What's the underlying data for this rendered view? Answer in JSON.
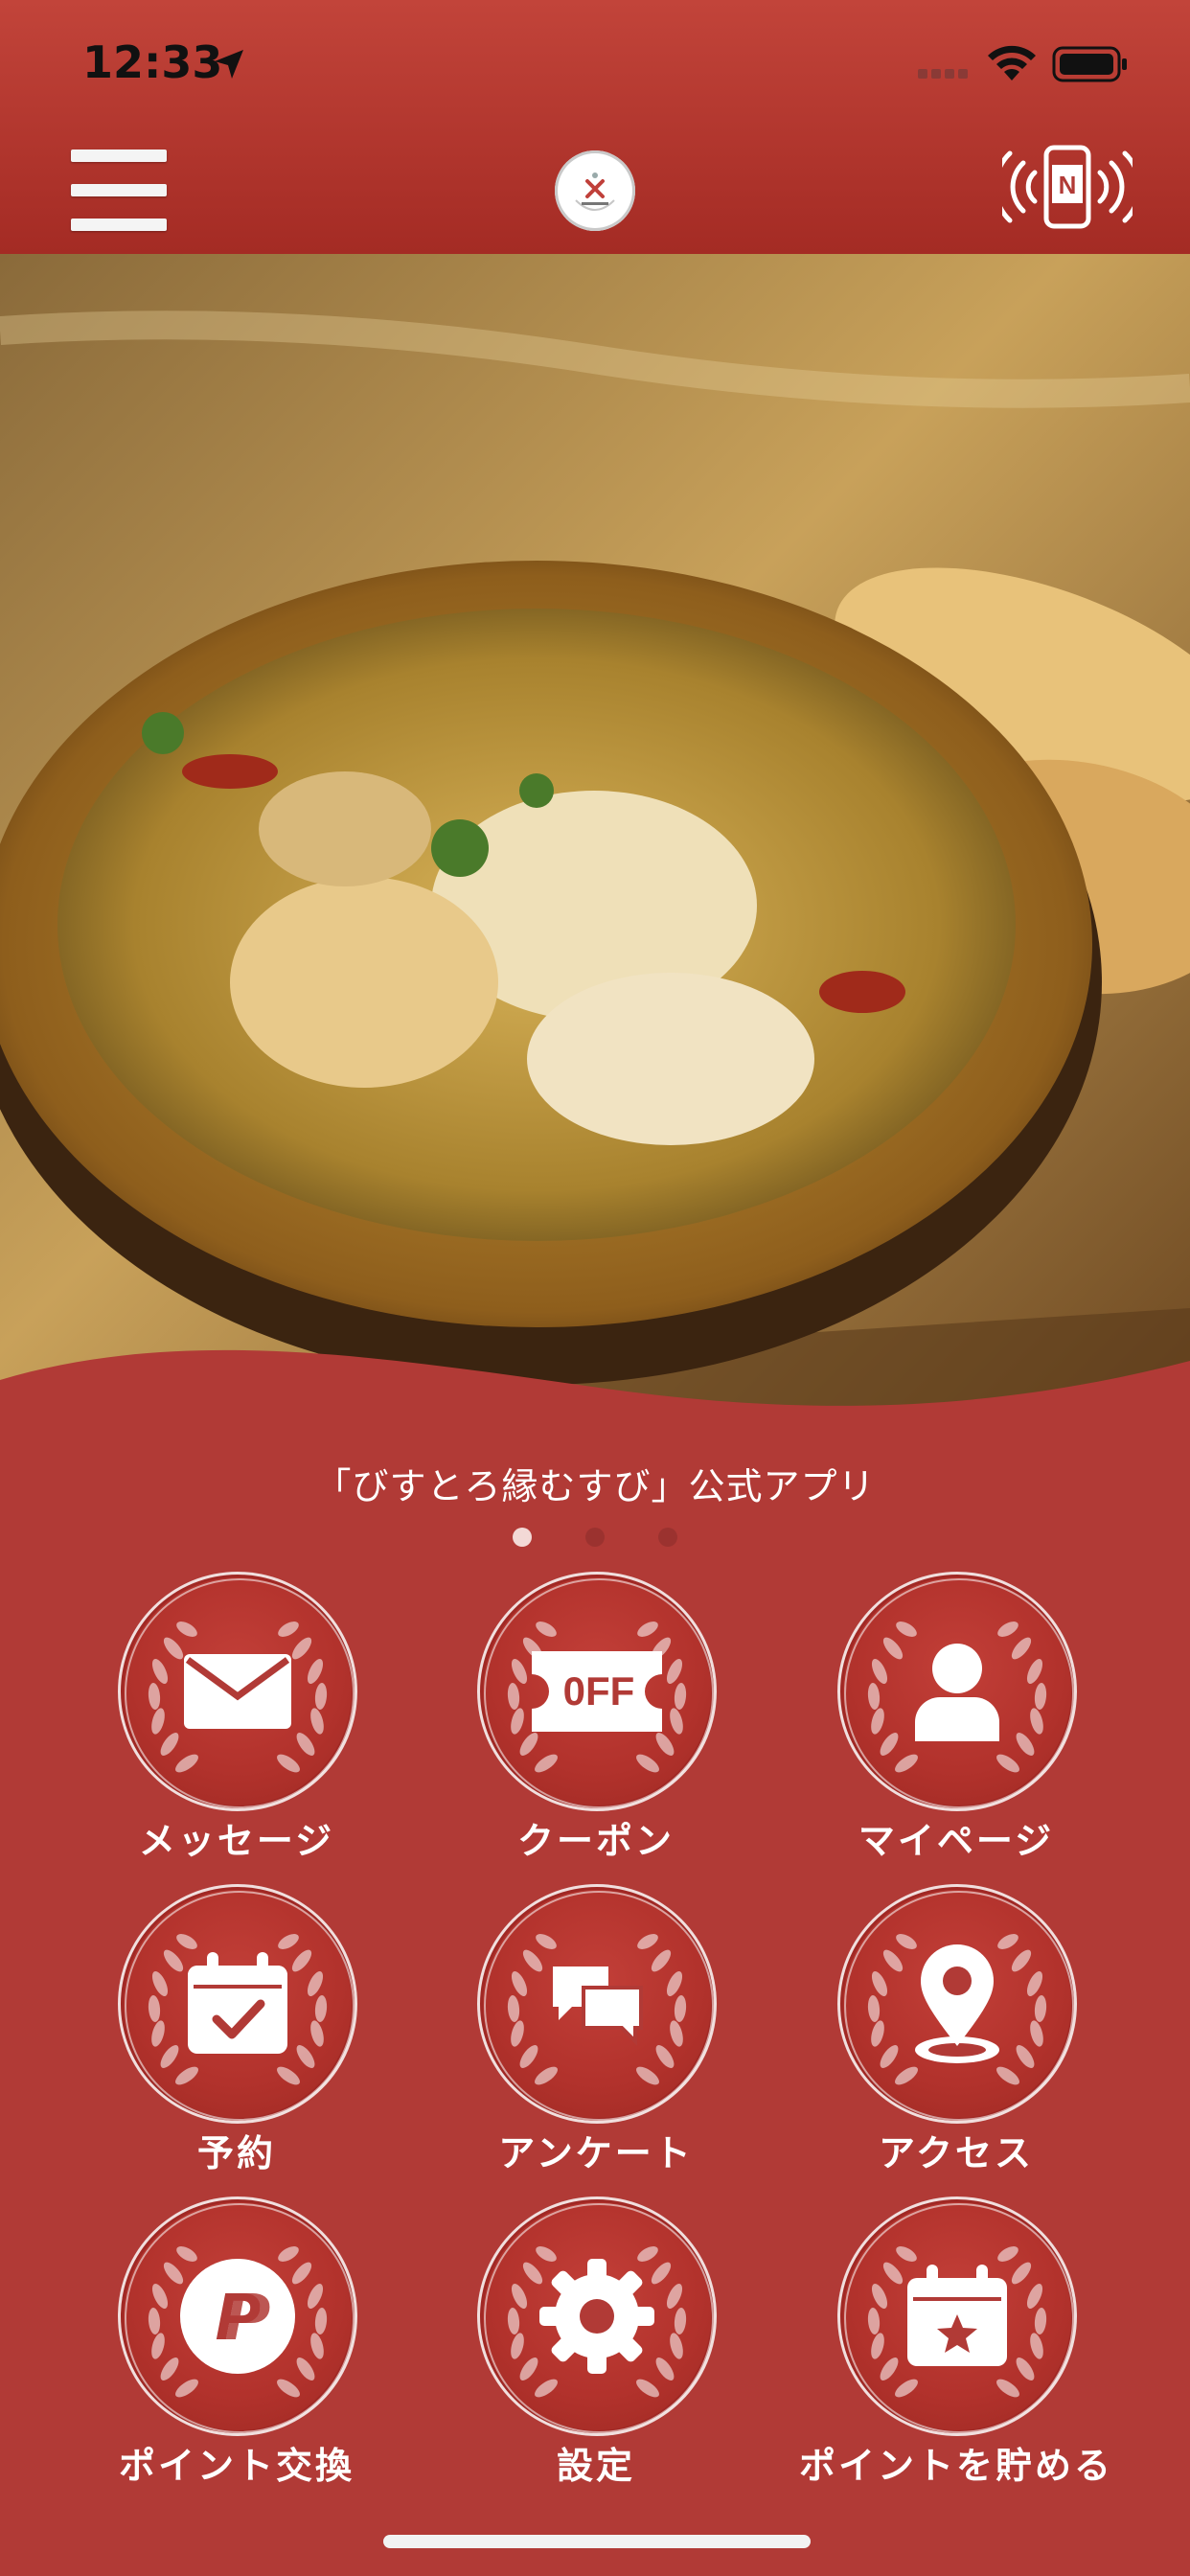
{
  "status_bar": {
    "time": "12:33"
  },
  "header": {
    "logo": "logo-icon",
    "menu": "hamburger-icon",
    "nfc": "nfc-phone-icon"
  },
  "main": {
    "app_title": "「びすとろ縁むすび」公式アプリ",
    "page_dots": {
      "count": 3,
      "active": 1
    }
  },
  "menu": {
    "items": [
      {
        "label": "メッセージ",
        "icon": "envelope-icon"
      },
      {
        "label": "クーポン",
        "icon": "coupon-off-icon",
        "icon_text": "0FF"
      },
      {
        "label": "マイページ",
        "icon": "person-icon"
      },
      {
        "label": "予約",
        "icon": "calendar-check-icon"
      },
      {
        "label": "アンケート",
        "icon": "chat-bubbles-icon"
      },
      {
        "label": "アクセス",
        "icon": "map-pin-icon"
      },
      {
        "label": "ポイント交換",
        "icon": "points-p-icon"
      },
      {
        "label": "設定",
        "icon": "gear-icon"
      },
      {
        "label": "ポイントを貯める",
        "icon": "calendar-star-icon"
      }
    ]
  },
  "colors": {
    "primary": "#b13a36",
    "header": "#a42b24",
    "text": "#ffffff"
  }
}
